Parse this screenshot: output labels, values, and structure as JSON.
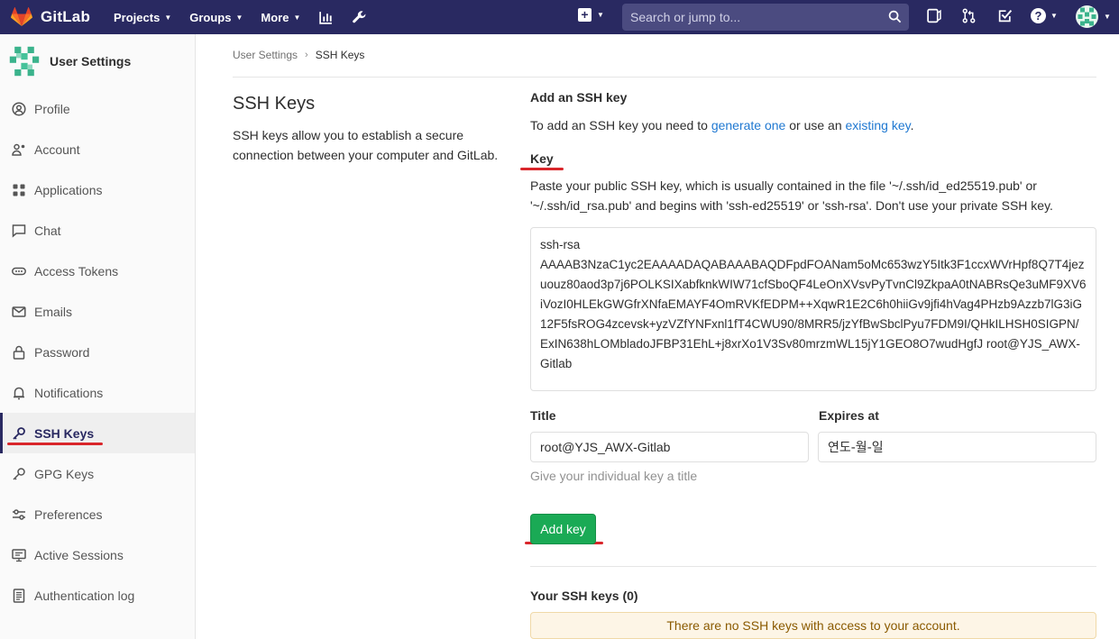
{
  "navbar": {
    "brand": "GitLab",
    "menu": [
      {
        "label": "Projects"
      },
      {
        "label": "Groups"
      },
      {
        "label": "More"
      }
    ],
    "search_placeholder": "Search or jump to..."
  },
  "sidebar": {
    "title": "User Settings",
    "items": [
      {
        "label": "Profile",
        "icon": "profile-icon"
      },
      {
        "label": "Account",
        "icon": "account-icon"
      },
      {
        "label": "Applications",
        "icon": "applications-icon"
      },
      {
        "label": "Chat",
        "icon": "chat-icon"
      },
      {
        "label": "Access Tokens",
        "icon": "token-icon"
      },
      {
        "label": "Emails",
        "icon": "mail-icon"
      },
      {
        "label": "Password",
        "icon": "lock-icon"
      },
      {
        "label": "Notifications",
        "icon": "bell-icon"
      },
      {
        "label": "SSH Keys",
        "icon": "key-icon"
      },
      {
        "label": "GPG Keys",
        "icon": "key-icon"
      },
      {
        "label": "Preferences",
        "icon": "preferences-icon"
      },
      {
        "label": "Active Sessions",
        "icon": "monitor-icon"
      },
      {
        "label": "Authentication log",
        "icon": "log-icon"
      }
    ]
  },
  "breadcrumb": {
    "parent": "User Settings",
    "sep": "›",
    "current": "SSH Keys"
  },
  "intro_panel": {
    "title": "SSH Keys",
    "description": "SSH keys allow you to establish a secure connection between your computer and GitLab."
  },
  "form": {
    "heading": "Add an SSH key",
    "intro_before": "To add an SSH key you need to ",
    "intro_link1": "generate one",
    "intro_middle": " or use an ",
    "intro_link2": "existing key",
    "intro_after": ".",
    "key_label": "Key",
    "key_help": "Paste your public SSH key, which is usually contained in the file '~/.ssh/id_ed25519.pub' or '~/.ssh/id_rsa.pub' and begins with 'ssh-ed25519' or 'ssh-rsa'. Don't use your private SSH key.",
    "key_value": "ssh-rsa\nAAAAB3NzaC1yc2EAAAADAQABAAABAQDFpdFOANam5oMc653wzY5Itk3F1ccxWVrHpf8Q7T4jezuouz80aod3p7j6POLKSIXabfknkWIW71cfSboQF4LeOnXVsvPyTvnCl9ZkpaA0tNABRsQe3uMF9XV6iVozI0HLEkGWGfrXNfaEMAYF4OmRVKfEDPM++XqwR1E2C6h0hiiGv9jfi4hVag4PHzb9Azzb7lG3iG12F5fsROG4zcevsk+yzVZfYNFxnl1fT4CWU90/8MRR5/jzYfBwSbclPyu7FDM9I/QHkILHSH0SIGPN/ExIN638hLOMbladoJFBP31EhL+j8xrXo1V3Sv80mrzmWL15jY1GEO8O7wudHgfJ root@YJS_AWX-Gitlab",
    "title_label": "Title",
    "title_value": "root@YJS_AWX-Gitlab",
    "title_hint": "Give your individual key a title",
    "expires_label": "Expires at",
    "expires_value": "연도-월-일",
    "submit_label": "Add key",
    "your_keys_label": "Your SSH keys (0)",
    "empty_message": "There are no SSH keys with access to your account."
  },
  "colors": {
    "navbar": "#292961",
    "accent_green": "#1aaa55",
    "link": "#1f78d1",
    "highlight_red": "#d9262b"
  }
}
